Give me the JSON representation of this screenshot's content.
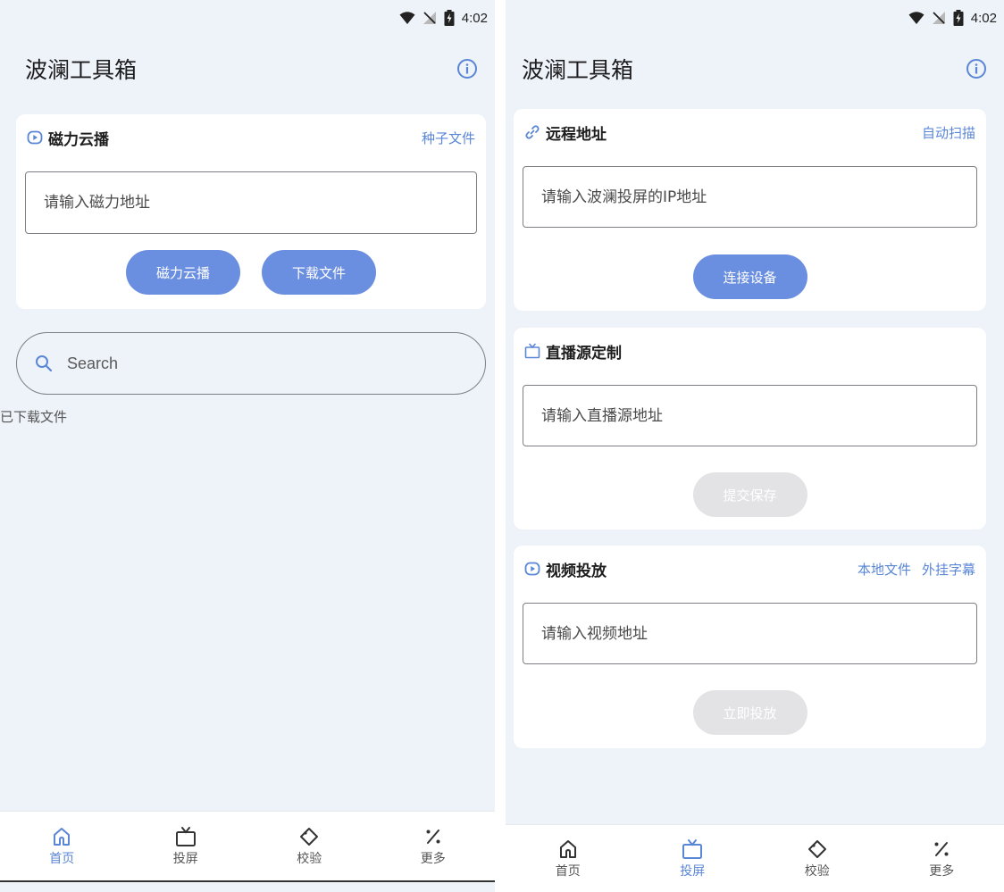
{
  "status": {
    "time": "4:02"
  },
  "left": {
    "app_title": "波澜工具箱",
    "magnet_card": {
      "title": "磁力云播",
      "link": "种子文件",
      "placeholder": "请输入磁力地址",
      "btn_play": "磁力云播",
      "btn_download": "下载文件"
    },
    "search": {
      "placeholder": "Search"
    },
    "downloaded_label": "已下载文件",
    "nav": [
      {
        "label": "首页",
        "icon": "home-icon",
        "active": true
      },
      {
        "label": "投屏",
        "icon": "tv-icon",
        "active": false
      },
      {
        "label": "校验",
        "icon": "tag-icon",
        "active": false
      },
      {
        "label": "更多",
        "icon": "percent-icon",
        "active": false
      }
    ]
  },
  "right": {
    "app_title": "波澜工具箱",
    "remote_card": {
      "title": "远程地址",
      "link": "自动扫描",
      "placeholder": "请输入波澜投屏的IP地址",
      "btn": "连接设备"
    },
    "live_card": {
      "title": "直播源定制",
      "placeholder": "请输入直播源地址",
      "btn": "提交保存"
    },
    "video_card": {
      "title": "视频投放",
      "link1": "本地文件",
      "link2": "外挂字幕",
      "placeholder": "请输入视频地址",
      "btn": "立即投放"
    },
    "nav": [
      {
        "label": "首页",
        "icon": "home-icon",
        "active": false
      },
      {
        "label": "投屏",
        "icon": "tv-icon",
        "active": true
      },
      {
        "label": "校验",
        "icon": "tag-icon",
        "active": false
      },
      {
        "label": "更多",
        "icon": "percent-icon",
        "active": false
      }
    ]
  },
  "colors": {
    "accent": "#6b8fe0",
    "link": "#5a86d6",
    "background": "#eef2f9",
    "disabled": "#e3e3e6"
  }
}
